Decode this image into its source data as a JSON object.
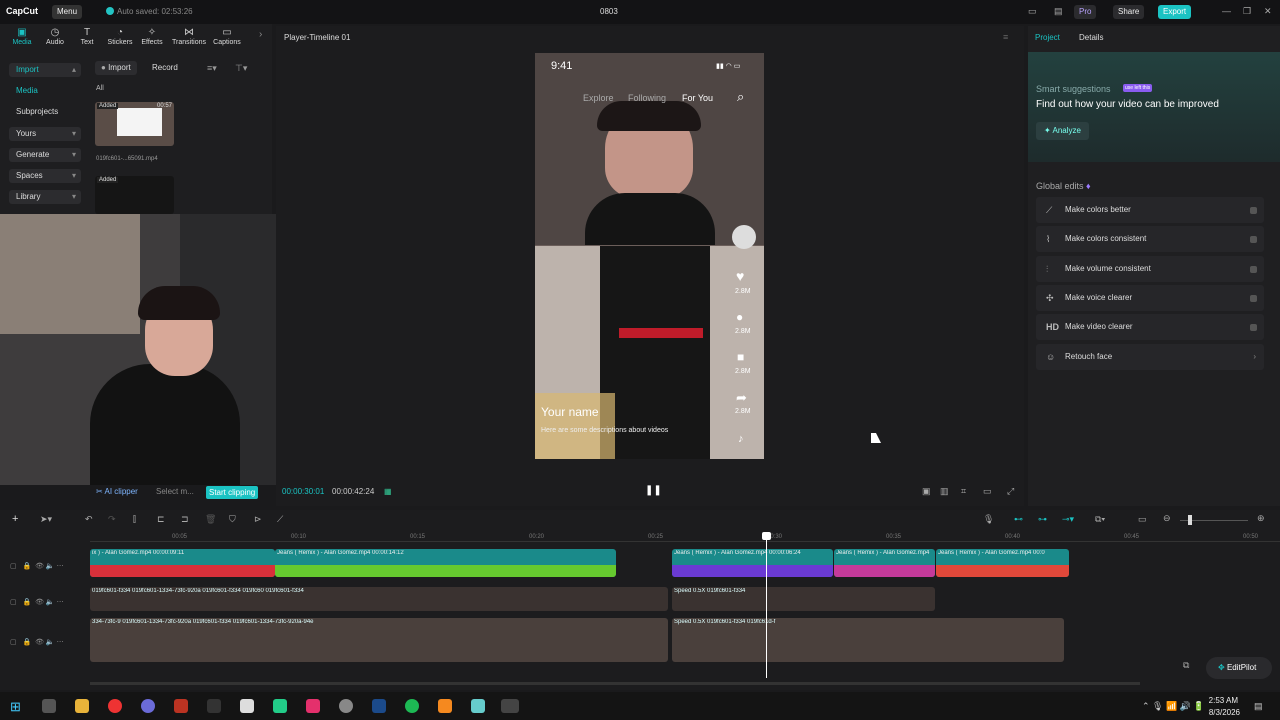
{
  "titlebar": {
    "logo": "CapCut",
    "menu": "Menu",
    "autosave": "Auto saved: 02:53:26",
    "project_title": "0803",
    "pro": "Pro",
    "share": "Share",
    "export": "Export"
  },
  "tabs": [
    {
      "label": "Media",
      "icon": "media-icon"
    },
    {
      "label": "Audio",
      "icon": "audio-icon"
    },
    {
      "label": "Text",
      "icon": "text-icon"
    },
    {
      "label": "Stickers",
      "icon": "stickers-icon"
    },
    {
      "label": "Effects",
      "icon": "effects-icon"
    },
    {
      "label": "Transitions",
      "icon": "transitions-icon"
    },
    {
      "label": "Captions",
      "icon": "captions-icon"
    }
  ],
  "sidebar": {
    "import": "Import",
    "media": "Media",
    "subprojects": "Subprojects",
    "yours": "Yours",
    "generate": "Generate",
    "spaces": "Spaces",
    "library": "Library"
  },
  "media": {
    "import_btn": "Import",
    "record_btn": "Record",
    "filter_all": "All",
    "items": [
      {
        "badge": "Added",
        "duration": "00:57",
        "name": "019fc601-...65091.mp4"
      },
      {
        "badge": "Added"
      }
    ]
  },
  "clipper": {
    "ai_clipper": "AI clipper",
    "select_placeholder": "Select m...",
    "start_clipping": "Start clipping"
  },
  "player": {
    "title": "Player-Timeline 01",
    "current_time": "00:00:30:01",
    "total_time": "00:00:42:24"
  },
  "phone": {
    "time": "9:41",
    "nav": [
      "Explore",
      "Following",
      "For You"
    ],
    "counts": [
      "2.8M",
      "2.8M",
      "2.8M",
      "2.8M"
    ],
    "name": "Your name",
    "description": "Here are some descriptions about videos"
  },
  "right_panel": {
    "tab_project": "Project",
    "tab_details": "Details",
    "smart_suggestions": "Smart suggestions",
    "badge": "use left this",
    "headline": "Find out how your video can be improved",
    "analyze": "Analyze",
    "global_edits": "Global edits",
    "edits": [
      {
        "label": "Make colors better",
        "icon": "wand-icon"
      },
      {
        "label": "Make colors consistent",
        "icon": "brush-icon"
      },
      {
        "label": "Make volume consistent",
        "icon": "sliders-icon"
      },
      {
        "label": "Make voice clearer",
        "icon": "voice-icon"
      },
      {
        "label": "Make video clearer",
        "icon": "hd-icon"
      },
      {
        "label": "Retouch face",
        "icon": "face-icon"
      }
    ]
  },
  "ruler": [
    "00:05",
    "00:10",
    "00:15",
    "00:20",
    "00:25",
    "00:30",
    "00:35",
    "00:40",
    "00:45",
    "00:50"
  ],
  "audio_track": {
    "clips": [
      {
        "label": "ix ) - Alan Gomez.mp4  00:00:09:11",
        "color": "#d8303a"
      },
      {
        "label": "Jeans ( Remix ) - Alan Gomez.mp4  00:00:14:12",
        "color": "#66c92f"
      },
      {
        "label": "Jeans ( Remix ) - Alan Gomez.mp4  00:00:06:24",
        "color": "#6a3ad3"
      },
      {
        "label": "Jeans ( Remix ) - Alan Gomez.mp4",
        "color": "#c43a9a"
      },
      {
        "label": "Jeans ( Remix ) - Alan Gomez.mp4  00:0",
        "color": "#e0483a"
      }
    ]
  },
  "video_track1": {
    "label": "019fc601-f334  019fc601-1334-73fc-920a  019fc601-f334  019fc60  019fc601-f334",
    "speed": "Speed 0.5X  019fc601-f334"
  },
  "video_track2": {
    "label": "334-73fc-9  019fc601-1334-73fc-920a  019fc601-f334  019fc601-1334-73fc-920a-94e",
    "speed": "Speed 0.5X  019fc601-f334  019fc61d-f"
  },
  "editpilot": "EditPilot",
  "taskbar": {
    "time": "2:53 AM",
    "date": "8/3/2026"
  }
}
